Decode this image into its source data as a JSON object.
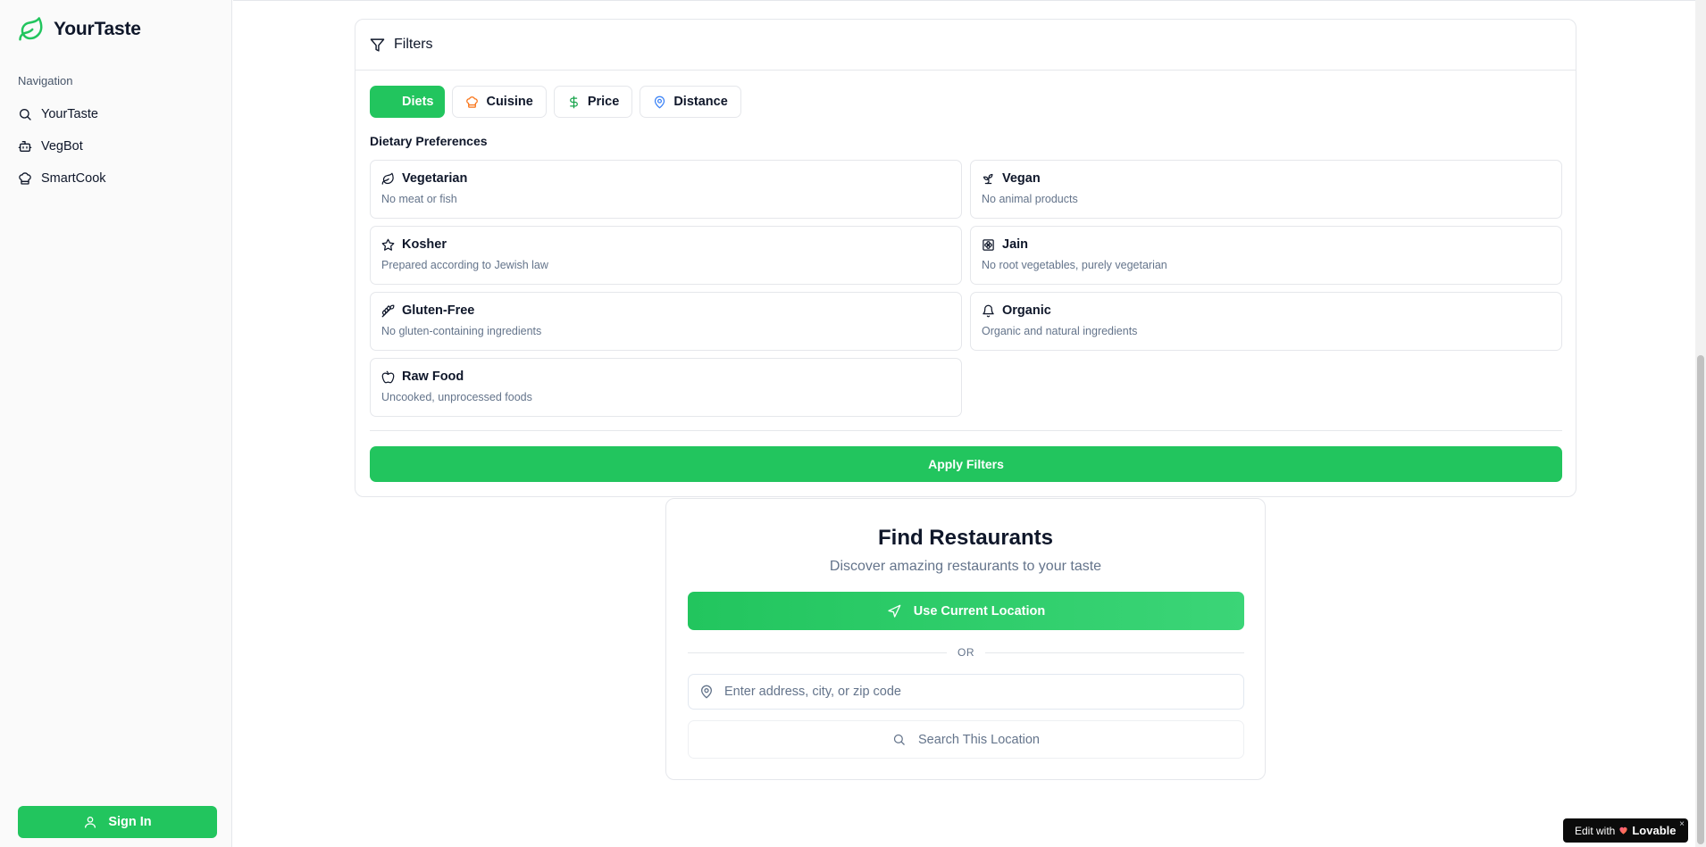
{
  "app": {
    "name": "YourTaste",
    "brand_color": "#22c55e"
  },
  "sidebar": {
    "heading": "Navigation",
    "items": [
      {
        "label": "YourTaste",
        "icon": "search-icon"
      },
      {
        "label": "VegBot",
        "icon": "bot-icon"
      },
      {
        "label": "SmartCook",
        "icon": "chef-hat-icon"
      }
    ],
    "sign_in_label": "Sign In"
  },
  "filters": {
    "title": "Filters",
    "tabs": [
      {
        "label": "Diets",
        "active": true
      },
      {
        "label": "Cuisine",
        "icon": "chef-hat-icon",
        "icon_color": "#f97316"
      },
      {
        "label": "Price",
        "icon": "dollar-icon",
        "icon_color": "#16a34a"
      },
      {
        "label": "Distance",
        "icon": "map-pin-icon",
        "icon_color": "#3b82f6"
      }
    ],
    "section_heading": "Dietary Preferences",
    "diets": [
      {
        "title": "Vegetarian",
        "desc": "No meat or fish",
        "icon": "leaf-icon"
      },
      {
        "title": "Vegan",
        "desc": "No animal products",
        "icon": "sprout-icon"
      },
      {
        "title": "Kosher",
        "desc": "Prepared according to Jewish law",
        "icon": "star-icon"
      },
      {
        "title": "Jain",
        "desc": "No root vegetables, purely vegetarian",
        "icon": "flower-icon"
      },
      {
        "title": "Gluten-Free",
        "desc": "No gluten-containing ingredients",
        "icon": "wheat-off-icon"
      },
      {
        "title": "Organic",
        "desc": "Organic and natural ingredients",
        "icon": "bell-icon"
      },
      {
        "title": "Raw Food",
        "desc": "Uncooked, unprocessed foods",
        "icon": "apple-icon"
      }
    ],
    "apply_label": "Apply Filters"
  },
  "find": {
    "title": "Find Restaurants",
    "subtitle": "Discover amazing restaurants to your taste",
    "use_location_label": "Use Current Location",
    "or_label": "OR",
    "address_placeholder": "Enter address, city, or zip code",
    "address_value": "",
    "search_label": "Search This Location"
  },
  "badge": {
    "prefix": "Edit with",
    "brand": "Lovable",
    "close": "×"
  }
}
